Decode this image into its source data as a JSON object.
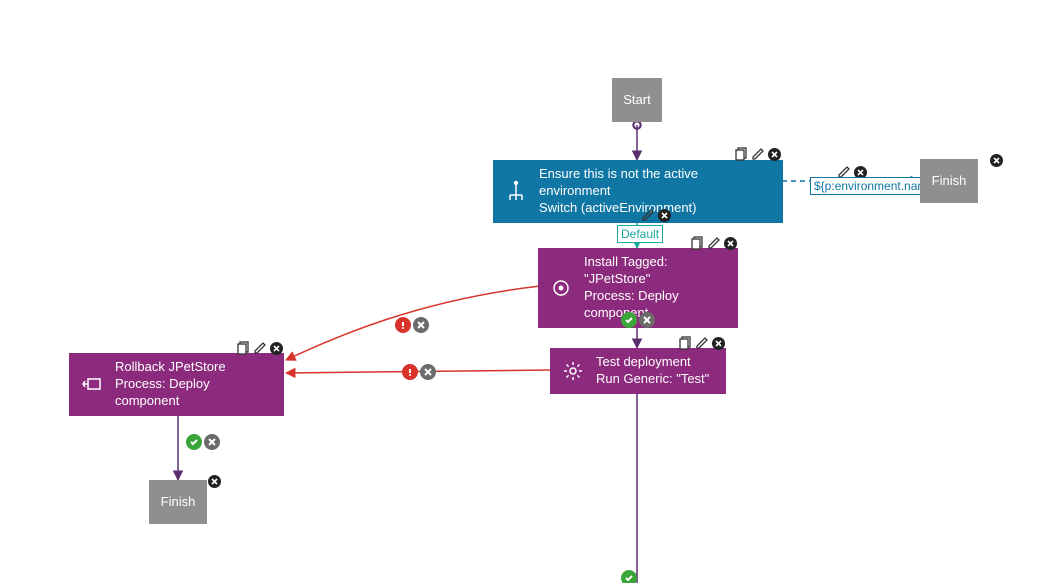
{
  "nodes": {
    "start": {
      "label": "Start"
    },
    "finish_r": {
      "label": "Finish"
    },
    "finish_b": {
      "label": "Finish"
    },
    "switch": {
      "line1": "Ensure this is not the active environment",
      "line2": "Switch (activeEnvironment)"
    },
    "install": {
      "line1": "Install Tagged: \"JPetStore\"",
      "line2": "Process: Deploy component"
    },
    "test": {
      "line1": "Test deployment",
      "line2": "Run Generic: \"Test\""
    },
    "rollback": {
      "line1": "Rollback JPetStore",
      "line2": "Process: Deploy component"
    }
  },
  "edge_labels": {
    "default": "Default",
    "env_var": "${p:environment.name}"
  },
  "colors": {
    "gray": "#8f8f8f",
    "blue": "#1076a3",
    "purple": "#8c2a7d",
    "teal": "#1aa99b",
    "error": "#d9342b",
    "ok": "#3aa63a",
    "line_dark": "#5a2e6f"
  }
}
